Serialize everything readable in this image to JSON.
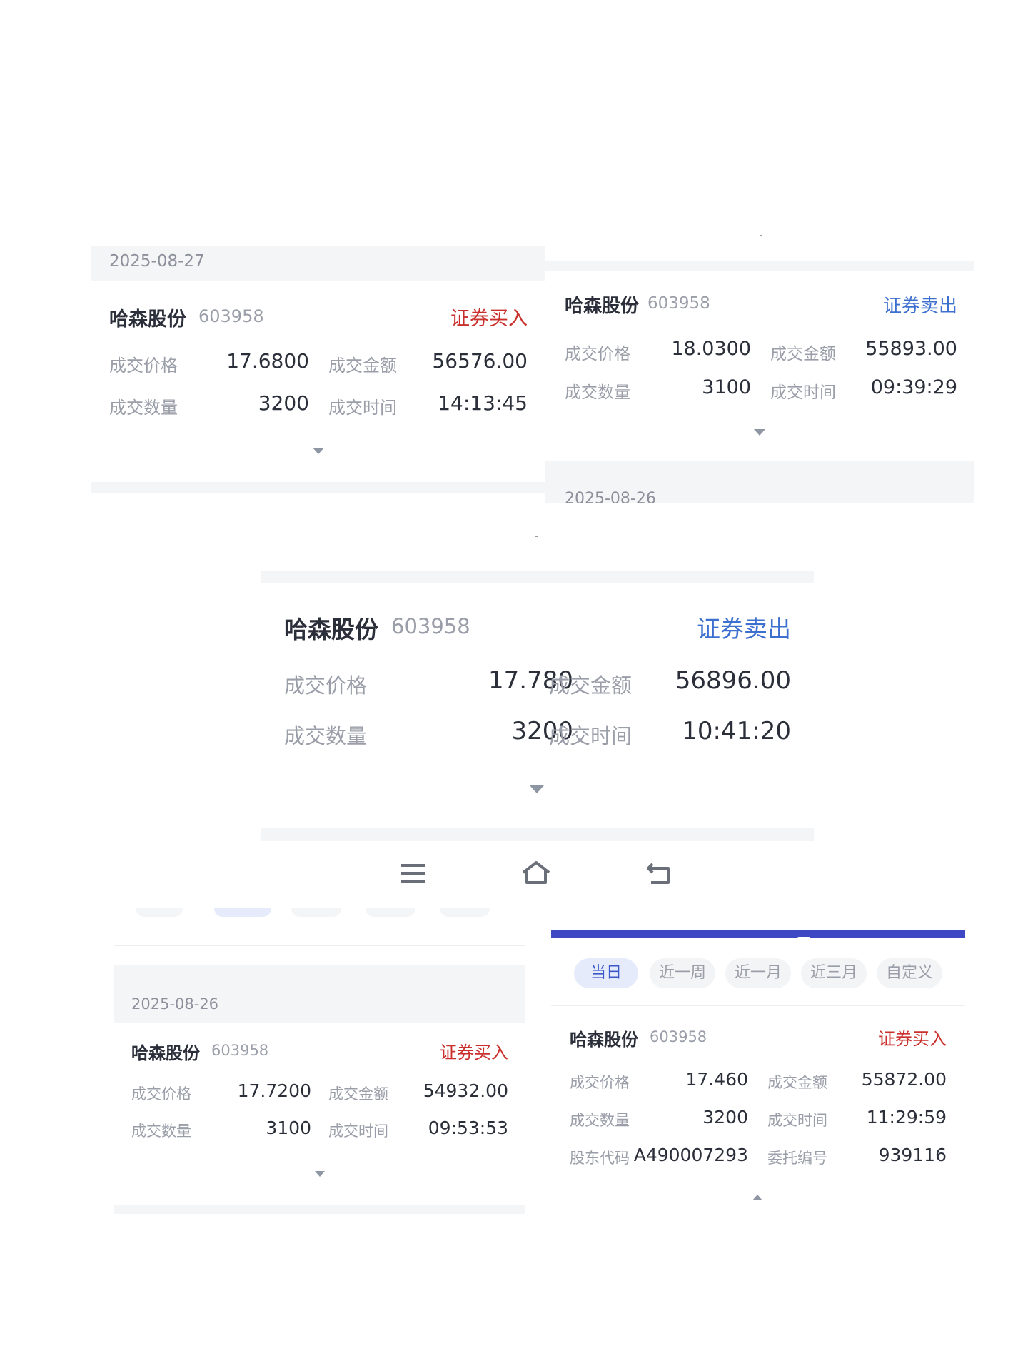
{
  "top_left": {
    "date": "2025-08-27",
    "stock_name": "哈森股份",
    "stock_code": "603958",
    "action": "证券买入",
    "price_label": "成交价格",
    "price": "17.6800",
    "amount_label": "成交金额",
    "amount": "56576.00",
    "qty_label": "成交数量",
    "qty": "3200",
    "time_label": "成交时间",
    "time": "14:13:45"
  },
  "top_right": {
    "stock_name": "哈森股份",
    "stock_code": "603958",
    "action": "证券卖出",
    "price_label": "成交价格",
    "price": "18.0300",
    "amount_label": "成交金额",
    "amount": "55893.00",
    "qty_label": "成交数量",
    "qty": "3100",
    "time_label": "成交时间",
    "time": "09:39:29",
    "next_date": "2025-08-26"
  },
  "middle": {
    "stock_name": "哈森股份",
    "stock_code": "603958",
    "action": "证券卖出",
    "price_label": "成交价格",
    "price": "17.780",
    "amount_label": "成交金额",
    "amount": "56896.00",
    "qty_label": "成交数量",
    "qty": "3200",
    "time_label": "成交时间",
    "time": "10:41:20"
  },
  "nav": {
    "menu_icon": "menu-icon",
    "home_icon": "home-icon",
    "back_icon": "back-icon"
  },
  "bottom_left": {
    "date": "2025-08-26",
    "stock_name": "哈森股份",
    "stock_code": "603958",
    "action": "证券买入",
    "price_label": "成交价格",
    "price": "17.7200",
    "amount_label": "成交金额",
    "amount": "54932.00",
    "qty_label": "成交数量",
    "qty": "3100",
    "time_label": "成交时间",
    "time": "09:53:53"
  },
  "bottom_right": {
    "filters": [
      "当日",
      "近一周",
      "近一月",
      "近三月",
      "自定义"
    ],
    "active_filter": "当日",
    "accent_color": "#3f48c4",
    "stock_name": "哈森股份",
    "stock_code": "603958",
    "action": "证券买入",
    "price_label": "成交价格",
    "price": "17.460",
    "amount_label": "成交金额",
    "amount": "55872.00",
    "qty_label": "成交数量",
    "qty": "3200",
    "time_label": "成交时间",
    "time": "11:29:59",
    "holder_label": "股东代码",
    "holder": "A490007293",
    "order_label": "委托编号",
    "order": "939116"
  },
  "colors": {
    "buy": "#c9302c",
    "sell": "#3d6fcf",
    "band": "#f4f5f7"
  }
}
